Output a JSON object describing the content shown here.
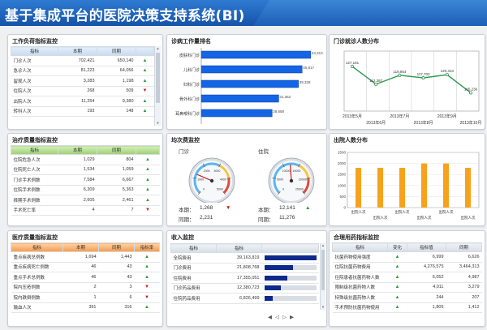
{
  "title": "基于集成平台的医院决策支持系统(BI)",
  "colors": {
    "banner": "#1c5fb6",
    "bar_blue": "#1464e6",
    "bar_orange": "#f7a21b",
    "line_green": "#2e9a50",
    "up": "#2e9a36",
    "down": "#d11b1b"
  },
  "workload": {
    "title": "工作负荷指标监控",
    "headers": [
      "指标",
      "本期",
      "同期"
    ],
    "rows": [
      {
        "name": "门诊人次",
        "cur": "702,421",
        "prev": "650,140",
        "trend": "up"
      },
      {
        "name": "急诊人次",
        "cur": "81,223",
        "prev": "64,056",
        "trend": "up"
      },
      {
        "name": "留观人次",
        "cur": "3,283",
        "prev": "1,198",
        "trend": "up"
      },
      {
        "name": "住院人次",
        "cur": "268",
        "prev": "509",
        "trend": "down"
      },
      {
        "name": "出院人次",
        "cur": "11,254",
        "prev": "9,380",
        "trend": "up"
      },
      {
        "name": "转科人次",
        "cur": "193",
        "prev": "148",
        "trend": "up"
      }
    ]
  },
  "dept_rank": {
    "title": "诊病工作量排名",
    "chart_data": {
      "type": "bar",
      "orientation": "horizontal",
      "categories": [
        "皮肤科门诊",
        "儿科门诊",
        "妇科门诊",
        "骨外科门诊",
        "耳鼻喉科门诊"
      ],
      "values": [
        44313,
        40817,
        39328,
        31352,
        28658
      ],
      "value_labels": [
        "44,313",
        "40,817",
        "39,328",
        "31,352",
        "28,658"
      ],
      "xlim": [
        0,
        46000
      ]
    }
  },
  "outpatient_trend": {
    "title": "门诊就诊人数分布",
    "chart_data": {
      "type": "line",
      "x": [
        "2013年5月",
        "2013年6月",
        "2013年7月",
        "2013年8月",
        "2013年9月",
        "2013年10月"
      ],
      "x_labels_row1": [
        "2013年5月",
        "2013年7月",
        "2013年9月"
      ],
      "x_labels_row2": [
        "2013年6月",
        "2013年8月",
        "2013年10月"
      ],
      "values": [
        127181,
        112387,
        119854,
        117703,
        120313,
        105236
      ],
      "value_labels": [
        "127,181",
        "112,387",
        "119,854",
        "117,703",
        "120,313",
        "105,236"
      ],
      "ylim": [
        0,
        140000
      ]
    }
  },
  "treatment_quality": {
    "title": "治疗质量指标监控",
    "headers": [
      "指标",
      "本期",
      "同期"
    ],
    "rows": [
      {
        "name": "住院危急人次",
        "cur": "1,029",
        "prev": "804",
        "trend": "up"
      },
      {
        "name": "住院死亡人次",
        "cur": "1,534",
        "prev": "1,059",
        "trend": "up"
      },
      {
        "name": "门诊手术例数",
        "cur": "7,584",
        "prev": "6,667",
        "trend": "up"
      },
      {
        "name": "住院手术例数",
        "cur": "6,309",
        "prev": "5,363",
        "trend": "up"
      },
      {
        "name": "择期手术例数",
        "cur": "2,605",
        "prev": "2,461",
        "trend": "up"
      },
      {
        "name": "手术死亡率",
        "cur": "4",
        "prev": "7",
        "trend": "down"
      }
    ]
  },
  "visits": {
    "title": "均次费监控",
    "gauge1": {
      "label": "门诊",
      "current_label": "本期：",
      "current": "1,268",
      "prev_label": "同期：",
      "prev": "2,231",
      "trend": "down",
      "scale": [
        "0",
        "1000",
        "2000",
        "3000",
        "4000",
        "5000"
      ],
      "value": 1268,
      "max": 5000
    },
    "gauge2": {
      "label": "住院",
      "current_label": "本期：",
      "current": "12,141",
      "prev_label": "同期：",
      "prev": "11,276",
      "trend": "up",
      "scale": [
        "0",
        "5000",
        "10000",
        "15000",
        "20000",
        "25000"
      ],
      "value": 12141,
      "max": 25000
    }
  },
  "discharge": {
    "title": "出院人数分布",
    "chart_data": {
      "type": "bar",
      "x_labels_row1": [
        "出院人次",
        "出院人次",
        "出院人次"
      ],
      "x_labels_row2": [
        "出院人次",
        "出院人次",
        "出院人次"
      ],
      "values": [
        1800,
        1800,
        1800,
        2000,
        2000,
        1800
      ],
      "ylim": [
        0,
        2500
      ],
      "yticks": [
        "0",
        "500",
        "1000",
        "1500",
        "2000",
        "2500"
      ]
    }
  },
  "medical_quality": {
    "title": "医疗质量指标监控",
    "headers": [
      "指标",
      "本期",
      "同期",
      "指标率"
    ],
    "rows": [
      {
        "name": "重点疾病总例数",
        "cur": "1,694",
        "prev": "1,443",
        "trend": "up"
      },
      {
        "name": "重点疾病死亡例数",
        "cur": "46",
        "prev": "43",
        "trend": "up"
      },
      {
        "name": "重点手术总例数",
        "cur": "46",
        "prev": "43",
        "trend": "up"
      },
      {
        "name": "院内压疮例数",
        "cur": "2",
        "prev": "3",
        "trend": "down"
      },
      {
        "name": "院内跌倒例数",
        "cur": "1",
        "prev": "6",
        "trend": "down"
      },
      {
        "name": "输血人次",
        "cur": "391",
        "prev": "316",
        "trend": "up"
      }
    ]
  },
  "income": {
    "title": "收入监控",
    "headers": [
      "指标",
      "指标"
    ],
    "rows": [
      {
        "name": "全院费用",
        "value": "39,163,819",
        "ratio": 1.0
      },
      {
        "name": "门诊费用",
        "value": "21,808,768",
        "ratio": 0.56
      },
      {
        "name": "住院费用",
        "value": "17,355,051",
        "ratio": 0.44
      },
      {
        "name": "门诊药品费用",
        "value": "12,380,723",
        "ratio": 0.32
      },
      {
        "name": "住院药品费用",
        "value": "6,826,499",
        "ratio": 0.17
      }
    ]
  },
  "drug_usage": {
    "title": "合理用药指标监控",
    "headers": [
      "指标",
      "变化",
      "指标值",
      "同期"
    ],
    "rows": [
      {
        "name": "抗菌药物使用强度",
        "cur": "6,999",
        "prev": "6,626",
        "trend": "up"
      },
      {
        "name": "住院抗菌药物费用",
        "cur": "4,276,575",
        "prev": "3,464,313",
        "trend": "up"
      },
      {
        "name": "住院患者抗菌药物人数",
        "cur": "6,052",
        "prev": "4,987",
        "trend": "up"
      },
      {
        "name": "限制级抗菌药物人数",
        "cur": "4,011",
        "prev": "3,279",
        "trend": "up"
      },
      {
        "name": "特殊级抗菌药物人数",
        "cur": "244",
        "prev": "207",
        "trend": "up"
      },
      {
        "name": "手术预防抗菌药物使用",
        "cur": "1,805",
        "prev": "1,412",
        "trend": "up"
      }
    ]
  },
  "icons": {
    "up": "▲",
    "down": "▼",
    "scroll_up": "▲",
    "scroll_down": "▼",
    "nav": [
      "◀",
      "◁",
      "▷",
      "▶"
    ]
  }
}
